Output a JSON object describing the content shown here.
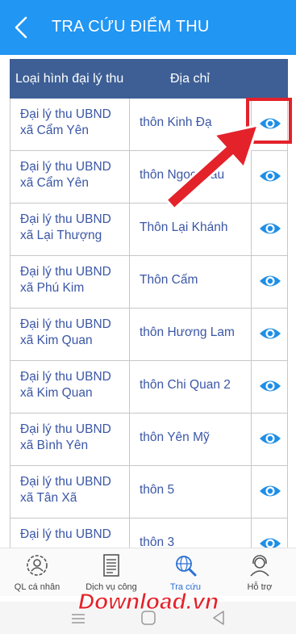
{
  "app": {
    "title": "TRA CỨU ĐIỂM THU",
    "back_icon": "chevron-left-icon",
    "header_color": "#2196f3"
  },
  "table": {
    "headers": [
      "Loại hình đại lý thu",
      "Địa chỉ"
    ],
    "header_color": "#3d5f95",
    "text_color": "#3b57a6",
    "rows": [
      {
        "type": "Đại lý thu UBND xã Cẩm Yên",
        "type_line1": "Đại lý thu UBND",
        "type_line2": "xã Cẩm Yên",
        "address": "thôn Kinh Đạ",
        "action_icon": "eye-icon"
      },
      {
        "type": "Đại lý thu UBND xã Cẩm Yên",
        "type_line1": "Đại lý thu UBND",
        "type_line2": "xã Cẩm Yên",
        "address": "thôn Ngoc Mau",
        "action_icon": "eye-icon"
      },
      {
        "type": "Đại lý thu UBND xã Lại Thượng",
        "type_line1": "Đại lý thu UBND",
        "type_line2": "xã Lại Thượng",
        "address": "Thôn Lại Khánh",
        "action_icon": "eye-icon"
      },
      {
        "type": "Đại lý thu UBND xã Phú Kim",
        "type_line1": "Đại lý thu UBND",
        "type_line2": "xã Phú Kim",
        "address": "Thôn Cấm",
        "action_icon": "eye-icon"
      },
      {
        "type": "Đại lý thu UBND xã Kim Quan",
        "type_line1": "Đại lý thu UBND",
        "type_line2": "xã Kim Quan",
        "address": "thôn Hương Lam",
        "action_icon": "eye-icon"
      },
      {
        "type": "Đại lý thu UBND xã Kim Quan",
        "type_line1": "Đại lý thu UBND",
        "type_line2": "xã Kim Quan",
        "address": "thôn Chi Quan 2",
        "action_icon": "eye-icon"
      },
      {
        "type": "Đại lý thu UBND xã Bình Yên",
        "type_line1": "Đại lý thu UBND",
        "type_line2": "xã Bình Yên",
        "address": "thôn Yên Mỹ",
        "action_icon": "eye-icon"
      },
      {
        "type": "Đại lý thu UBND xã Tân Xã",
        "type_line1": "Đại lý thu UBND",
        "type_line2": "xã Tân Xã",
        "address": "thôn 5",
        "action_icon": "eye-icon"
      },
      {
        "type": "Đại lý thu UBND",
        "type_line1": "Đại lý thu UBND",
        "type_line2": "",
        "address": "thôn 3",
        "action_icon": "eye-icon"
      }
    ]
  },
  "annotation": {
    "highlight_color": "#e3222a",
    "arrow_icon": "red-arrow-icon"
  },
  "bottom_nav": {
    "items": [
      {
        "label": "QL cá nhân",
        "icon": "profile-gear-icon",
        "active": false
      },
      {
        "label": "Dịch vụ công",
        "icon": "document-icon",
        "active": false
      },
      {
        "label": "Tra cứu",
        "icon": "search-globe-icon",
        "active": true
      },
      {
        "label": "Hỗ trợ",
        "icon": "support-headset-icon",
        "active": false
      }
    ],
    "active_color": "#2a6fd6"
  },
  "watermark": {
    "text": "Download.vn"
  },
  "system_nav": {
    "icons": [
      "menu-icon",
      "home-icon",
      "back-triangle-icon"
    ]
  }
}
